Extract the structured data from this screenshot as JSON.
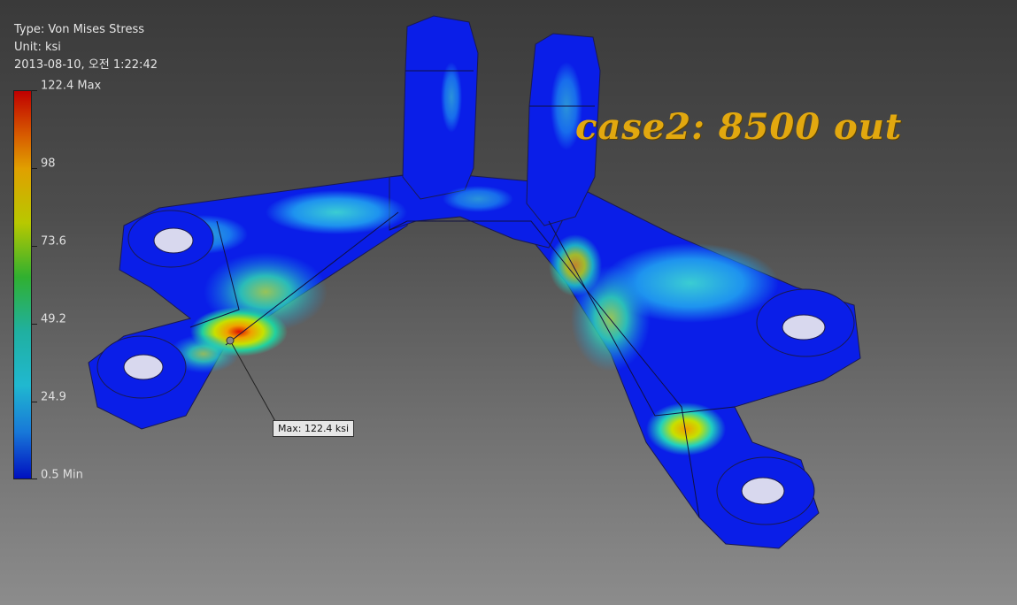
{
  "result_info": {
    "type_line": "Type: Von Mises Stress",
    "unit_line": "Unit: ksi",
    "timestamp_line": "2013-08-10, 오전 1:22:42"
  },
  "legend": {
    "labels": [
      "122.4 Max",
      "98",
      "73.6",
      "49.2",
      "24.9",
      "0.5 Min"
    ],
    "max_value": 122.4,
    "min_value": 0.5,
    "colors": [
      "#c00000",
      "#e0a000",
      "#b8c800",
      "#30b030",
      "#20b0b0",
      "#1890d0",
      "#0010c0"
    ]
  },
  "overlay": {
    "case_label": "case2: 8500 out",
    "case_color": "#e2a80f"
  },
  "probe": {
    "label": "Max: 122.4 ksi"
  },
  "model": {
    "base_color": "#0a1ee8",
    "hotspot_color": "#e01000"
  }
}
